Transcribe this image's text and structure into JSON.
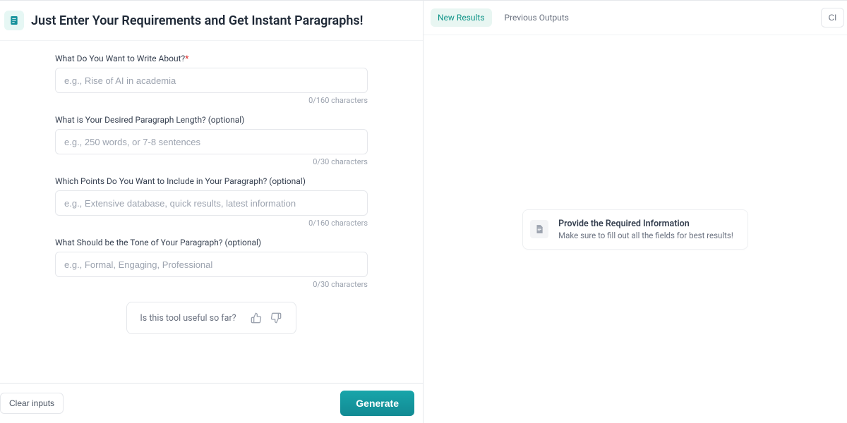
{
  "header": {
    "title": "Just Enter Your Requirements and Get Instant Paragraphs!"
  },
  "form": {
    "fields": [
      {
        "label": "What Do You Want to Write About?",
        "required": true,
        "placeholder": "e.g., Rise of AI in academia",
        "value": "",
        "counter": "0/160 characters"
      },
      {
        "label": "What is Your Desired Paragraph Length? (optional)",
        "required": false,
        "placeholder": "e.g., 250 words, or 7-8 sentences",
        "value": "",
        "counter": "0/30 characters"
      },
      {
        "label": "Which Points Do You Want to Include in Your Paragraph? (optional)",
        "required": false,
        "placeholder": "e.g., Extensive database, quick results, latest information",
        "value": "",
        "counter": "0/160 characters"
      },
      {
        "label": "What Should be the Tone of Your Paragraph? (optional)",
        "required": false,
        "placeholder": "e.g., Formal, Engaging, Professional",
        "value": "",
        "counter": "0/30 characters"
      }
    ],
    "feedback_prompt": "Is this tool useful so far?"
  },
  "footer": {
    "clear_label": "Clear inputs",
    "generate_label": "Generate"
  },
  "results": {
    "tabs": {
      "new": "New Results",
      "previous": "Previous Outputs"
    },
    "clear_label": "Cl",
    "empty_title": "Provide the Required Information",
    "empty_sub": "Make sure to fill out all the fields for best results!"
  }
}
